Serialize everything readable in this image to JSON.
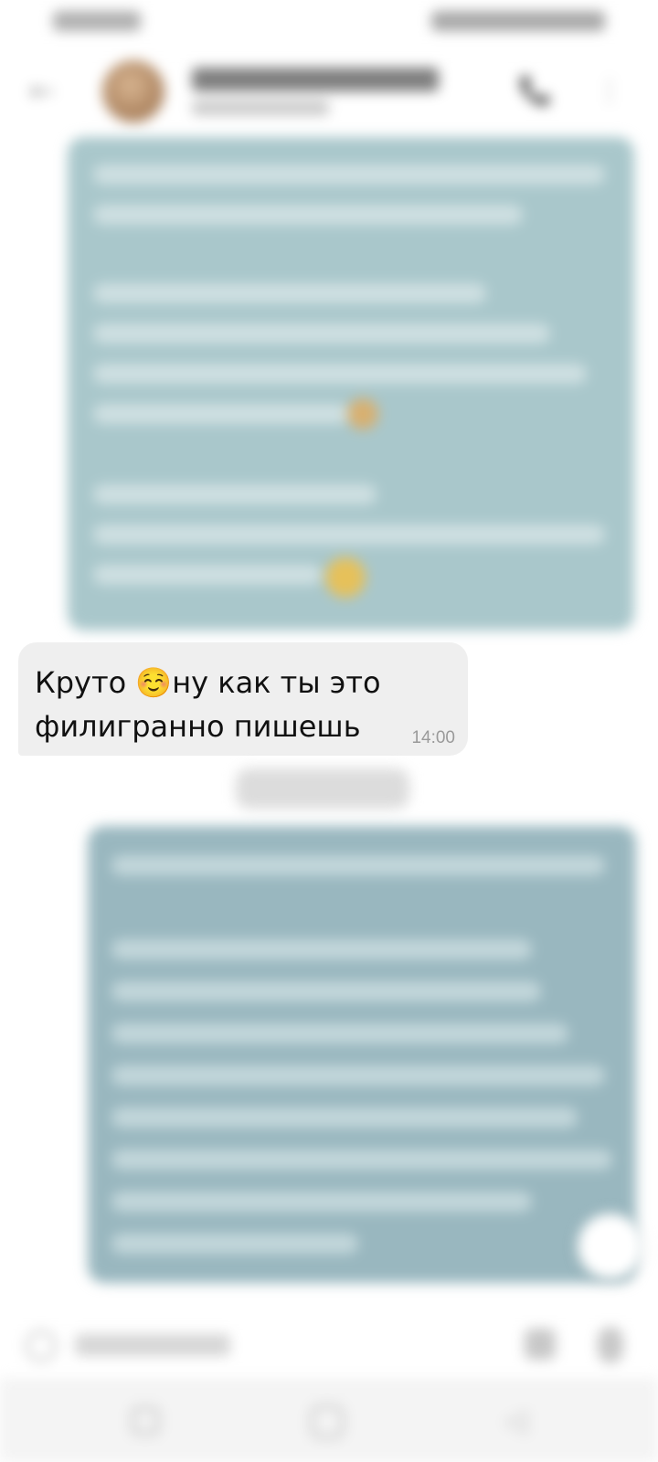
{
  "incoming_message": {
    "text": "Круто ☺️ну как ты это филигранно пишешь",
    "time": "14:00"
  },
  "icons": {
    "back": "←",
    "call": "📞",
    "menu": "⋮",
    "nav_back": "◁"
  },
  "colors": {
    "outgoing_bubble": "#a9c7cb",
    "incoming_bubble": "#efefef"
  }
}
